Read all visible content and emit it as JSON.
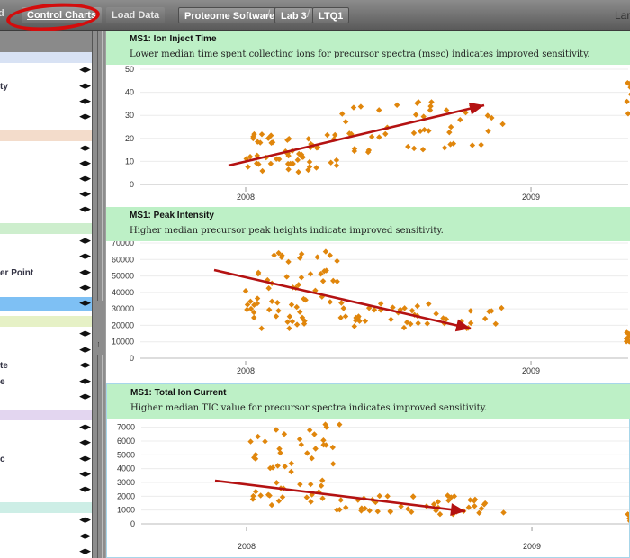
{
  "topbar": {
    "edge_text": "d",
    "tab_control": "Control Charts",
    "tab_load": "Load Data",
    "crumbs": [
      "Proteome Software",
      "Lab 3",
      "LTQ1"
    ],
    "crumb_separator": "/",
    "user_fragment": "Lar"
  },
  "colors": {
    "header_bg": "#bdf0c6",
    "marker": "#e0860c",
    "arrow": "#b41212",
    "highlight_oval": "#d40c0c",
    "selected_row": "#7ec0f4"
  },
  "sidebar": {
    "group_band_colors": [
      "#d8e2f4",
      "#f3dccb",
      "#cdeecd",
      "#e6f1c6",
      "#e3d6f0",
      "#cdeee6"
    ],
    "row_labels": [
      "ty",
      "er Point",
      "te",
      "e",
      "c"
    ],
    "arrows": "◀▶"
  },
  "panels": [
    {
      "title": "MS1: Ion Inject Time",
      "description": "Lower median time spent collecting ions for precursor spectra (msec) indicates improved sensitivity.",
      "yticks": [
        "0",
        "10",
        "20",
        "30",
        "40",
        "50"
      ],
      "xticks": [
        "2008",
        "2009"
      ],
      "chart_data": {
        "type": "scatter",
        "x_axis": "time (dates 2008-2009)",
        "ylim": [
          0,
          50
        ],
        "trend": "increasing",
        "clusters": [
          {
            "x_range": [
              "2008-01",
              "2008-05"
            ],
            "y_range": [
              5,
              22
            ]
          },
          {
            "x_range": [
              "2008-05",
              "2008-12"
            ],
            "y_range": [
              14,
              36
            ]
          },
          {
            "x_range": [
              "2009-05",
              "2009-06"
            ],
            "y_range": [
              27,
              50
            ]
          }
        ]
      }
    },
    {
      "title": "MS1: Peak Intensity",
      "description": "Higher median precursor peak heights indicate improved sensitivity.",
      "yticks": [
        "0",
        "10000",
        "20000",
        "30000",
        "40000",
        "50000",
        "60000",
        "70000"
      ],
      "xticks": [
        "2008",
        "2009"
      ],
      "chart_data": {
        "type": "scatter",
        "x_axis": "time (dates 2008-2009)",
        "ylim": [
          0,
          70000
        ],
        "trend": "decreasing",
        "clusters": [
          {
            "x_range": [
              "2008-01",
              "2008-05"
            ],
            "y_range": [
              18000,
              65000
            ]
          },
          {
            "x_range": [
              "2008-05",
              "2008-12"
            ],
            "y_range": [
              17000,
              34000
            ]
          },
          {
            "x_range": [
              "2009-05",
              "2009-06"
            ],
            "y_range": [
              10000,
              20000
            ]
          }
        ]
      }
    },
    {
      "title": "MS1: Total Ion Current",
      "description": "Higher median TIC value for precursor spectra indicates improved sensitivity.",
      "yticks": [
        "0",
        "1000",
        "2000",
        "3000",
        "4000",
        "5000",
        "6000",
        "7000"
      ],
      "xticks": [
        "2008",
        "2009"
      ],
      "chart_data": {
        "type": "scatter",
        "x_axis": "time (dates 2008-2009)",
        "ylim": [
          0,
          7500
        ],
        "trend": "decreasing",
        "clusters": [
          {
            "x_range": [
              "2008-01",
              "2008-05"
            ],
            "y_range": [
              1000,
              7300
            ]
          },
          {
            "x_range": [
              "2008-05",
              "2008-12"
            ],
            "y_range": [
              700,
              2100
            ]
          },
          {
            "x_range": [
              "2009-05",
              "2009-06"
            ],
            "y_range": [
              200,
              800
            ]
          }
        ]
      }
    }
  ]
}
